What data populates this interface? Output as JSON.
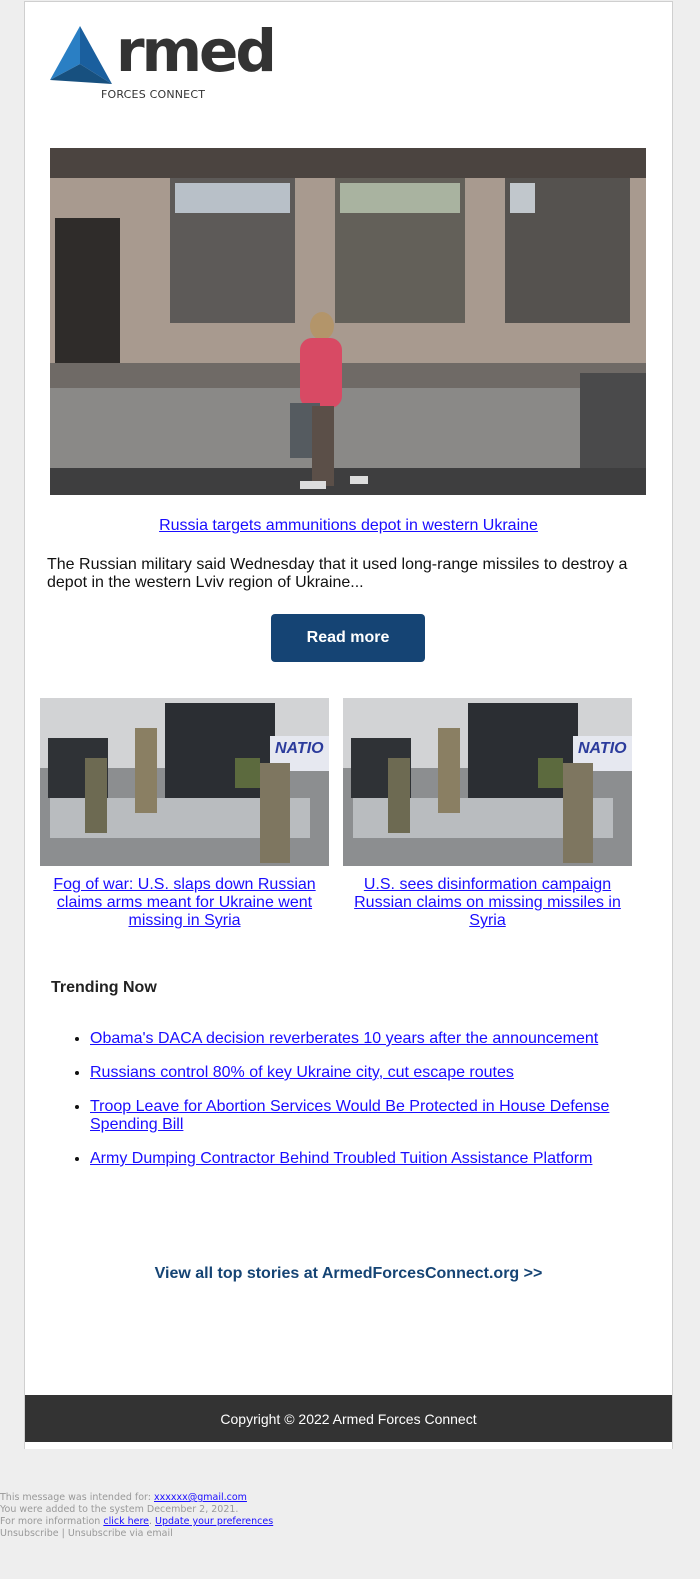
{
  "brand": {
    "logo_word": "rmed",
    "logo_subtitle": "FORCES CONNECT",
    "accent_color": "#1e6fb5",
    "button_color": "#154474"
  },
  "hero": {
    "image_alt": "Woman in pink shirt walking past a burned-out building",
    "headline": "Russia targets ammunitions depot in western Ukraine",
    "summary": "The Russian military said Wednesday that it used long-range missiles to destroy a depot in the western Lviv region of Ukraine...",
    "read_more_label": "Read more"
  },
  "secondary_stories": [
    {
      "image_alt": "Soldiers unloading pallets of missiles from an airport trailer",
      "title": "Fog of war: U.S. slaps down Russian claims arms meant for Ukraine went missing in Syria"
    },
    {
      "image_alt": "Soldiers unloading pallets of missiles from an airport trailer",
      "title": "U.S. sees disinformation campaign Russian claims on missing missiles in Syria"
    }
  ],
  "trending": {
    "title": "Trending Now",
    "items": [
      "Obama's DACA decision reverberates 10 years after the announcement",
      "Russians control 80% of key Ukraine city, cut escape routes",
      "Troop Leave for Abortion Services Would Be Protected in House Defense Spending Bill",
      "Army Dumping Contractor Behind Troubled Tuition Assistance Platform"
    ]
  },
  "view_all_label": "View all top stories at ArmedForcesConnect.org >>",
  "footer": {
    "copyright": "Copyright © 2022 Armed Forces Connect"
  },
  "meta": {
    "intended_prefix": "This message was intended for: ",
    "email": "xxxxxx@gmail.com",
    "added_line": "You were added to the system December 2, 2021.",
    "info_prefix": "For more information ",
    "click_here": "click here",
    "separator": ". ",
    "update_prefs": "Update your preferences",
    "unsubscribe": "Unsubscribe",
    "pipe": " | ",
    "unsubscribe_email": "Unsubscribe via email"
  }
}
